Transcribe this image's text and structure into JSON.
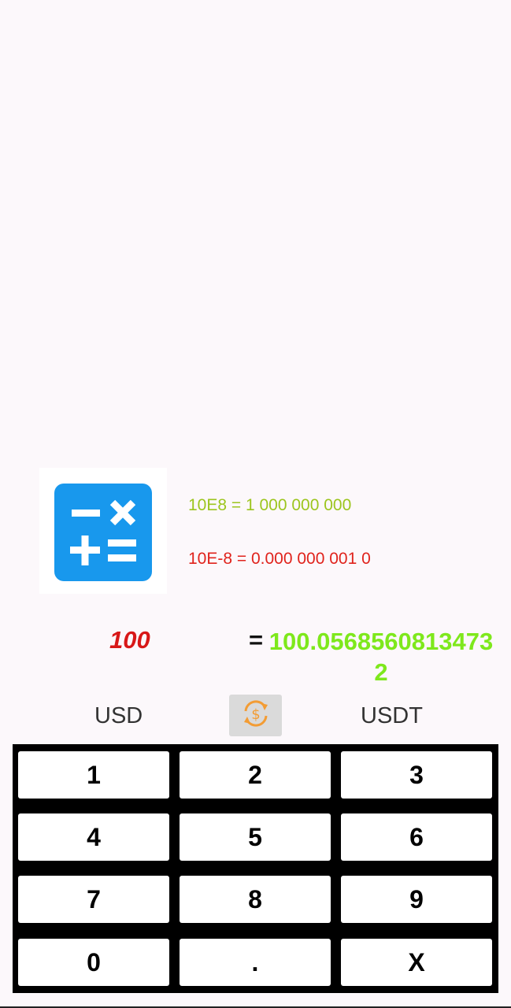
{
  "hints": {
    "line1": "10E8 = 1 000 000 000",
    "line2": "10E-8 = 0.000 000 001 0"
  },
  "conversion": {
    "input_value": "100",
    "equals": "=",
    "result_value": "100.05685608134732"
  },
  "currencies": {
    "from": "USD",
    "to": "USDT"
  },
  "keypad": {
    "keys": [
      "1",
      "2",
      "3",
      "4",
      "5",
      "6",
      "7",
      "8",
      "9",
      "0",
      ".",
      "X"
    ]
  },
  "icons": {
    "logo": "calculator-icon",
    "swap": "currency-swap-icon"
  },
  "colors": {
    "logo_bg": "#1898ed",
    "hint1": "#9cc51e",
    "hint2": "#e0231c",
    "input": "#d81818",
    "result": "#7ee81c",
    "swap_icon": "#f39c34"
  }
}
